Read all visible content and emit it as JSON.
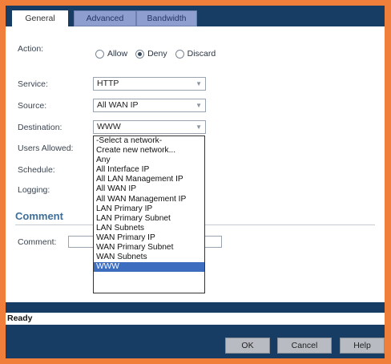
{
  "tabs": [
    {
      "label": "General",
      "active": true
    },
    {
      "label": "Advanced",
      "active": false
    },
    {
      "label": "Bandwidth",
      "active": false
    }
  ],
  "form": {
    "action_label": "Action:",
    "action_options": [
      "Allow",
      "Deny",
      "Discard"
    ],
    "action_selected": "Deny",
    "service_label": "Service:",
    "service_value": "HTTP",
    "source_label": "Source:",
    "source_value": "All WAN IP",
    "destination_label": "Destination:",
    "destination_value": "WWW",
    "users_label": "Users Allowed:",
    "schedule_label": "Schedule:",
    "logging_label": "Logging:"
  },
  "destination_dropdown": {
    "options": [
      "-Select a network-",
      "Create new network...",
      "Any",
      "All Interface IP",
      "All LAN Management IP",
      "All WAN IP",
      "All WAN Management IP",
      "LAN Primary IP",
      "LAN Primary Subnet",
      "LAN Subnets",
      "WAN Primary IP",
      "WAN Primary Subnet",
      "WAN Subnets",
      "WWW"
    ],
    "selected": "WWW"
  },
  "comment_section": {
    "title": "Comment",
    "label": "Comment:",
    "value": ""
  },
  "status": "Ready",
  "buttons": {
    "ok": "OK",
    "cancel": "Cancel",
    "help": "Help"
  },
  "colors": {
    "frame": "#f07f3c",
    "navy": "#173d64",
    "tab_inactive": "#8e9fcf",
    "selection": "#3d6dbf",
    "section_title": "#3f6f99"
  }
}
